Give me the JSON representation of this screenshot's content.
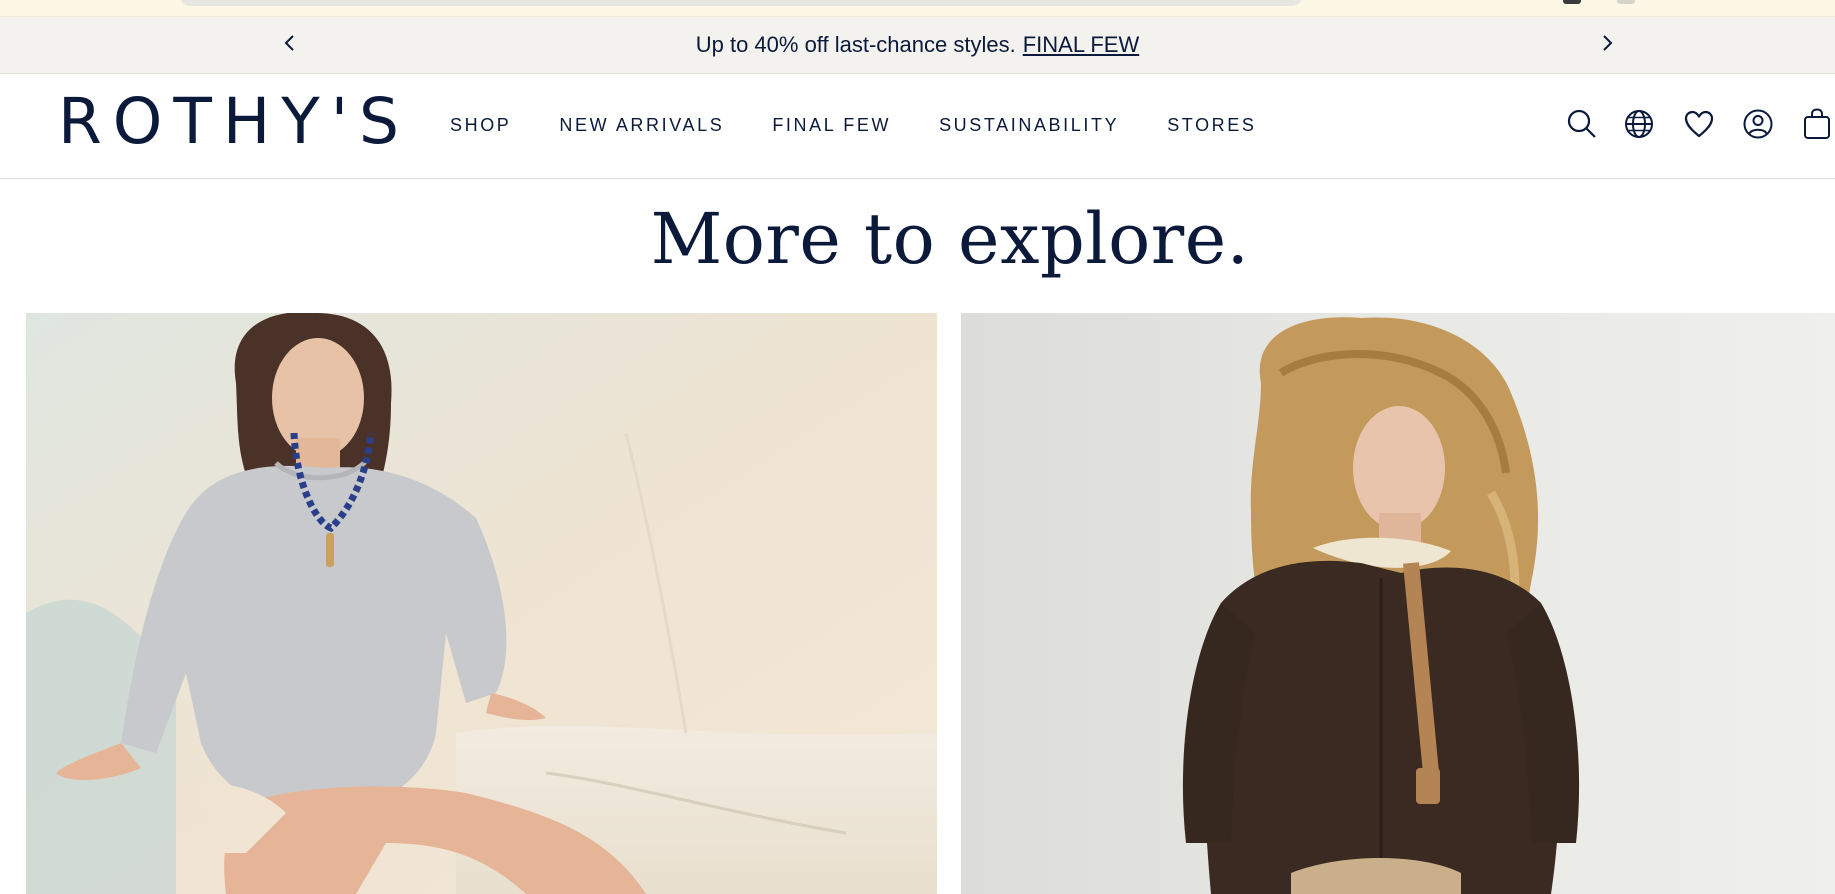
{
  "promo": {
    "text": "Up to 40% off last-chance styles.",
    "link": "FINAL FEW"
  },
  "brand": {
    "logo": "ROTHY'S"
  },
  "nav": {
    "items": [
      "SHOP",
      "NEW ARRIVALS",
      "FINAL FEW",
      "SUSTAINABILITY",
      "STORES"
    ]
  },
  "header_icons": [
    "search-icon",
    "globe-icon",
    "heart-icon",
    "account-icon",
    "bag-icon"
  ],
  "section": {
    "title": "More to explore."
  },
  "colors": {
    "navy": "#0b1a3a",
    "promo_bg": "#f3f2ee",
    "top_strip_bg": "#fdf8e6"
  }
}
